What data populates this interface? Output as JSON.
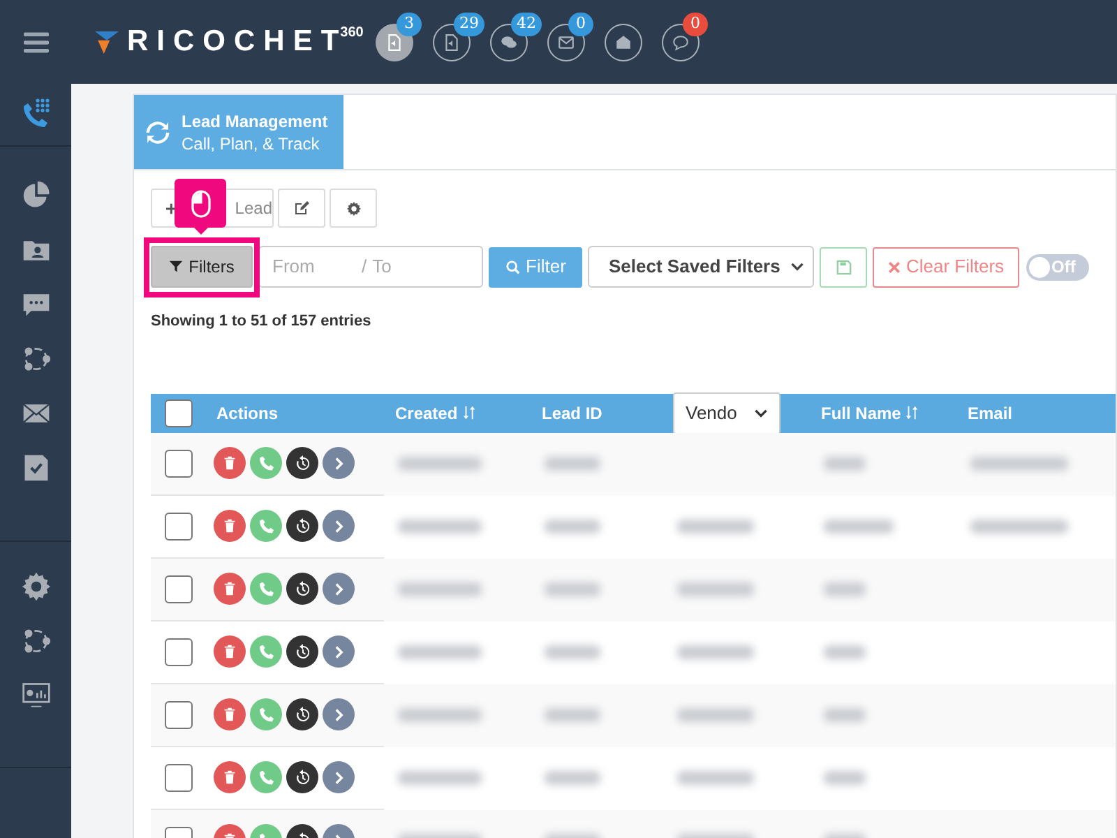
{
  "header": {
    "logo": "RICOCHET",
    "logo_sup": "360",
    "notifications": [
      {
        "selected": true,
        "badge": "3",
        "color": "#3498db"
      },
      {
        "selected": false,
        "badge": "29",
        "color": "#3498db"
      },
      {
        "selected": false,
        "badge": "42",
        "color": "#3498db"
      },
      {
        "selected": false,
        "badge": "0",
        "color": "#3498db"
      },
      {
        "selected": false
      },
      {
        "selected": false,
        "badge": "0",
        "color": "#e74c3c"
      }
    ]
  },
  "page": {
    "title": "Lead Management",
    "subtitle": "Call, Plan, & Track"
  },
  "toolbar": {
    "add_label": "Lead"
  },
  "filters": {
    "button": "Filters",
    "from_placeholder": "From",
    "separator": "/",
    "to_placeholder": "To",
    "filter_button": "Filter",
    "saved_filters": "Select Saved Filters",
    "clear_button": "Clear Filters",
    "toggle": {
      "on": false,
      "label": "Off"
    }
  },
  "info": "Showing 1 to 51 of 157 entries",
  "table": {
    "select_all": {
      "checked": false
    },
    "columns": [
      {
        "kind": "text",
        "label": "Actions"
      },
      {
        "kind": "text",
        "label": "Created",
        "sortable": true
      },
      {
        "kind": "text",
        "label": "Lead ID"
      },
      {
        "kind": "select",
        "label": "Vendo"
      },
      {
        "kind": "text",
        "label": "Full Name",
        "sortable": true
      },
      {
        "kind": "text",
        "label": "Email"
      }
    ],
    "rows": [
      {
        "checked": false
      },
      {
        "checked": false
      },
      {
        "checked": false
      },
      {
        "checked": false
      },
      {
        "checked": false
      },
      {
        "checked": false
      },
      {
        "checked": false
      }
    ]
  }
}
